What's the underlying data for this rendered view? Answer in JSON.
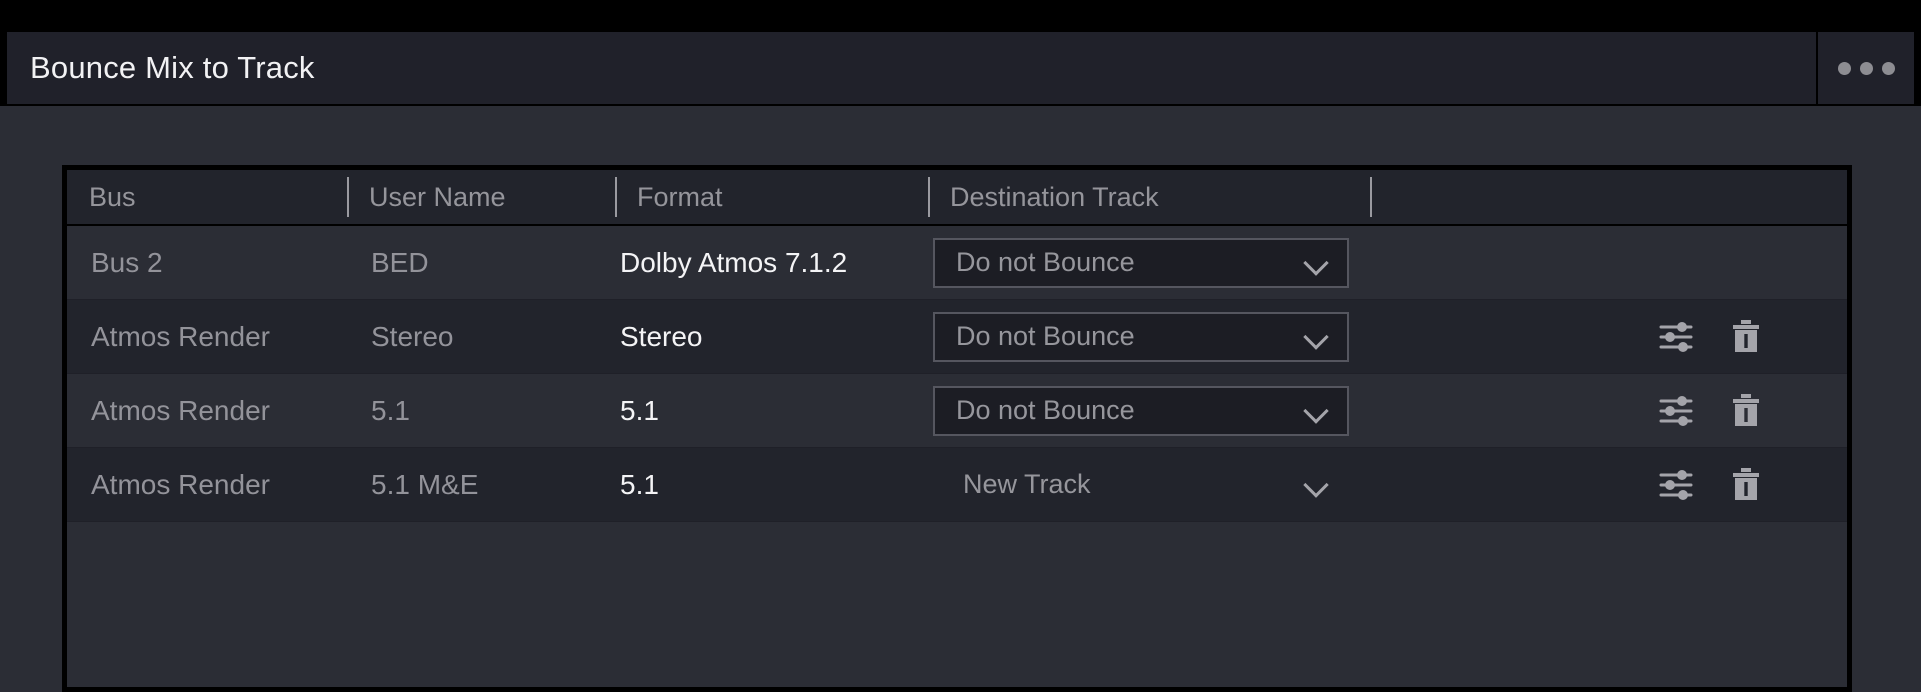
{
  "window": {
    "title": "Bounce Mix to Track",
    "overflow_menu_label": "•••",
    "overflow_icon": "ellipsis-icon"
  },
  "colors": {
    "app_background": "#000000",
    "panel_background": "#2b2d35",
    "row_alt_background": "#22242c",
    "titlebar_background": "#20212a",
    "title_text": "#f2f2f4",
    "muted_text": "#93939a",
    "bright_text": "#f4f4f6",
    "dropdown_fill": "#1c1d24",
    "dropdown_border": "#55565f",
    "icon": "#a4a4aa",
    "divider": "#9a9aa0"
  },
  "table": {
    "columns": [
      {
        "key": "bus",
        "label": "Bus"
      },
      {
        "key": "user",
        "label": "User Name"
      },
      {
        "key": "format",
        "label": "Format"
      },
      {
        "key": "dest",
        "label": "Destination Track"
      },
      {
        "key": "actions",
        "label": ""
      }
    ],
    "rows": [
      {
        "bus": "Bus 2",
        "user": "BED",
        "format": "Dolby Atmos 7.1.2",
        "destination": "Do not Bounce",
        "destination_style": "boxed",
        "has_actions": false,
        "settings_icon": "",
        "delete_icon": ""
      },
      {
        "bus": "Atmos Render",
        "user": "Stereo",
        "format": "Stereo",
        "destination": "Do not Bounce",
        "destination_style": "boxed",
        "has_actions": true,
        "settings_icon": "sliders-icon",
        "delete_icon": "trash-icon"
      },
      {
        "bus": "Atmos Render",
        "user": "5.1",
        "format": "5.1",
        "destination": "Do not Bounce",
        "destination_style": "boxed",
        "has_actions": true,
        "settings_icon": "sliders-icon",
        "delete_icon": "trash-icon"
      },
      {
        "bus": "Atmos Render",
        "user": "5.1 M&E",
        "format": "5.1",
        "destination": "New Track",
        "destination_style": "flat",
        "has_actions": true,
        "settings_icon": "sliders-icon",
        "delete_icon": "trash-icon"
      }
    ]
  }
}
